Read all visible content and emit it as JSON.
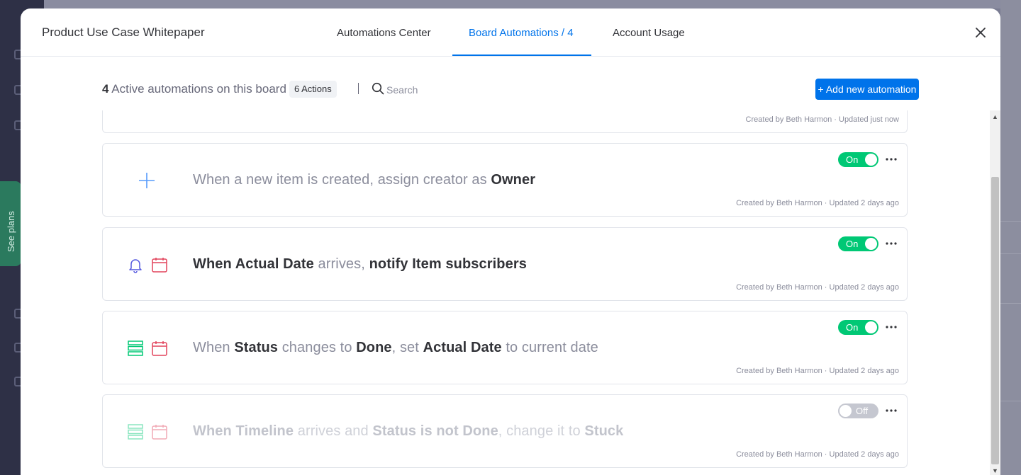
{
  "modal": {
    "board_title": "Product Use Case Whitepaper",
    "tabs": [
      {
        "label": "Automations Center"
      },
      {
        "label": "Board Automations / 4"
      },
      {
        "label": "Account Usage"
      }
    ],
    "close_icon": "close-icon"
  },
  "summary": {
    "count": "4",
    "label": "Active automations on this board",
    "actions_badge": "6 Actions",
    "search_placeholder": "Search",
    "add_button": "+ Add new automation"
  },
  "background": {
    "see_plans": "See plans"
  },
  "automations": [
    {
      "meta": "Created by Beth Harmon · Updated just now"
    },
    {
      "icons": [
        "plus-icon"
      ],
      "sentence": [
        {
          "t": "When a new item is created, assign creator as "
        },
        {
          "b": "Owner"
        }
      ],
      "toggle": "On",
      "meta": "Created by Beth Harmon · Updated 2 days ago"
    },
    {
      "icons": [
        "bell-icon",
        "calendar-icon"
      ],
      "sentence": [
        {
          "b": "When Actual Date"
        },
        {
          "t": " arrives, "
        },
        {
          "b": "notify Item subscribers"
        }
      ],
      "toggle": "On",
      "meta": "Created by Beth Harmon · Updated 2 days ago"
    },
    {
      "icons": [
        "status-list-icon",
        "calendar-icon"
      ],
      "sentence": [
        {
          "t": "When "
        },
        {
          "b": "Status"
        },
        {
          "t": " changes to "
        },
        {
          "b": "Done"
        },
        {
          "t": ", set "
        },
        {
          "b": "Actual Date"
        },
        {
          "t": " to current date"
        }
      ],
      "toggle": "On",
      "meta": "Created by Beth Harmon · Updated 2 days ago"
    },
    {
      "icons": [
        "status-list-icon",
        "calendar-icon"
      ],
      "sentence": [
        {
          "b": "When Timeline"
        },
        {
          "t": " arrives and "
        },
        {
          "b": "Status is not Done"
        },
        {
          "t": ", change it to "
        },
        {
          "b": "Stuck"
        }
      ],
      "toggle": "Off",
      "meta": "Created by Beth Harmon · Updated 2 days ago"
    }
  ],
  "colors": {
    "accent": "#0073ea",
    "toggle_on": "#00c875",
    "toggle_off": "#c5c7d0",
    "icon_plus": "#579bfc",
    "icon_bell": "#5559df",
    "icon_calendar": "#e2445c",
    "icon_status": "#00c875"
  }
}
